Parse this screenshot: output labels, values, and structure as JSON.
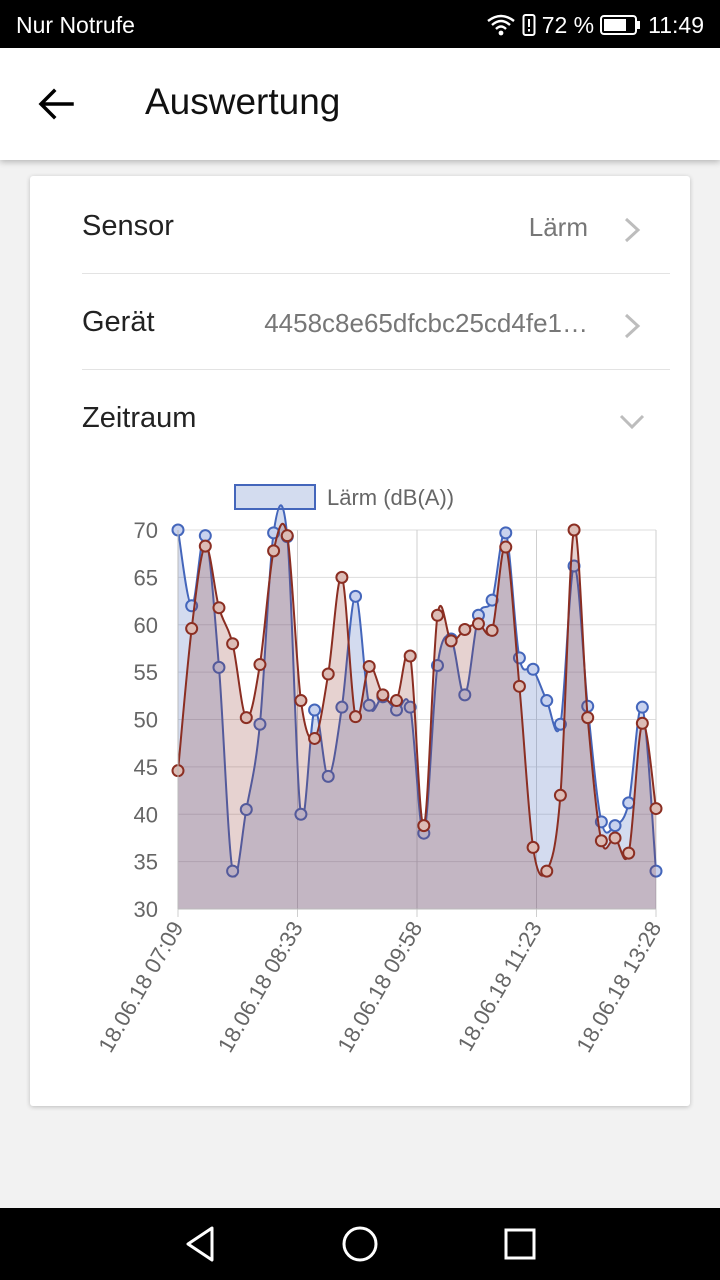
{
  "status": {
    "carrier": "Nur Notrufe",
    "battery": "72 %",
    "time": "11:49"
  },
  "appbar": {
    "title": "Auswertung",
    "back_icon": "arrow-left"
  },
  "settings": [
    {
      "label": "Sensor",
      "value": "Lärm",
      "icon": "chevron-right"
    },
    {
      "label": "Gerät",
      "value": "4458c8e65dfcbc25cd4fe1…",
      "icon": "chevron-right"
    },
    {
      "label": "Zeitraum",
      "value": "",
      "icon": "chevron-down"
    }
  ],
  "chart_data": {
    "type": "area",
    "legend": [
      "Lärm (dB(A))"
    ],
    "xlabels": [
      "18.06.18 07:09",
      "18.06.18 08:33",
      "18.06.18 09:58",
      "18.06.18 11:23",
      "18.06.18 13:28"
    ],
    "ylim": [
      30,
      70
    ],
    "yticks": [
      70,
      65,
      60,
      55,
      50,
      45,
      40,
      35,
      30
    ],
    "grid": true,
    "colors": {
      "series1": "#4466bb",
      "series2": "#8b2e22"
    },
    "series": [
      {
        "values": [
          70,
          62,
          69.4,
          55.5,
          34,
          40.5,
          49.5,
          69.7,
          69.3,
          40,
          51,
          44,
          51.3,
          63,
          51.5,
          52.4,
          51,
          51.3,
          38,
          55.7,
          58.5,
          52.6,
          61,
          62.6,
          69.7,
          56.5,
          55.3,
          52,
          49.5,
          66.2,
          51.4,
          39.2,
          38.8,
          41.2,
          51.3,
          34
        ]
      },
      {
        "values": [
          44.6,
          59.6,
          68.3,
          61.8,
          58,
          50.2,
          55.8,
          67.8,
          69.4,
          52,
          48,
          54.8,
          65,
          50.3,
          55.6,
          52.6,
          52,
          56.7,
          38.8,
          61,
          58.3,
          59.5,
          60.1,
          59.4,
          68.2,
          53.5,
          36.5,
          34,
          42,
          70.2,
          50.2,
          37.2,
          37.5,
          35.9,
          49.6,
          40.6
        ]
      }
    ]
  }
}
